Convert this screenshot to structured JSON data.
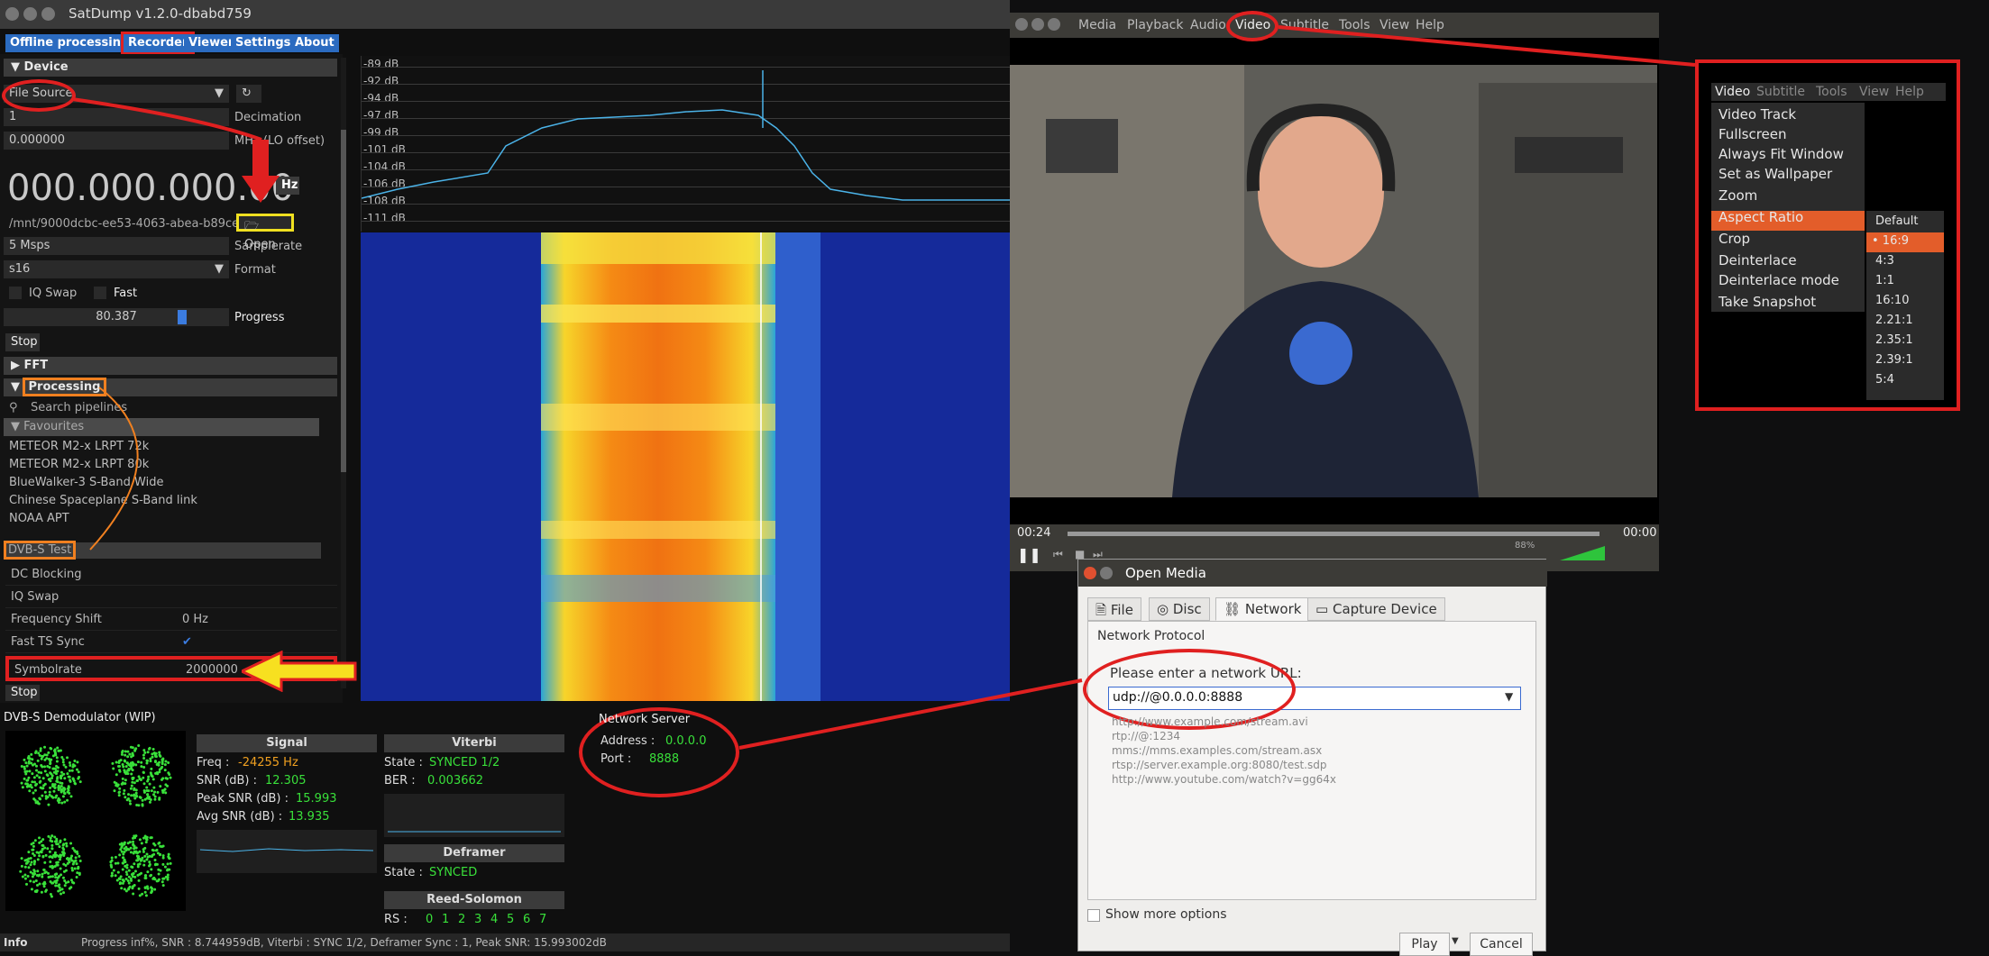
{
  "satdump": {
    "title": "SatDump v1.2.0-dbabd759",
    "menu": [
      "Offline processing",
      "Recorder",
      "Viewer",
      "Settings",
      "About"
    ],
    "device_header": "Device",
    "source": "File Source",
    "decimation_value": "1",
    "decimation_label": "Decimation",
    "lo_value": "0.000000",
    "lo_label": "MHz (LO offset)",
    "freq": "000.000.000.00",
    "hz": "Hz",
    "file_path": "/mnt/9000dcbc-ee53-4063-abea-b89ce",
    "open_label": "Open",
    "samplerate_value": "5 Msps",
    "samplerate_label": "Samplerate",
    "format_value": "s16",
    "format_label": "Format",
    "iq_swap": "IQ Swap",
    "fast": "Fast",
    "progress_value": "80.387",
    "progress_fraction": 0.80387,
    "progress_label": "Progress",
    "stop1": "Stop",
    "fft_header": "FFT",
    "processing_header": "Processing",
    "search_placeholder": "Search pipelines",
    "favourites": "Favourites",
    "pipelines": [
      "METEOR M2-x LRPT 72k",
      "METEOR M2-x LRPT 80k",
      "BlueWalker-3 S-Band Wide",
      "Chinese Spaceplane S-Band link",
      "NOAA APT",
      "DVB-S Test"
    ],
    "params": [
      {
        "k": "DC Blocking",
        "v": ""
      },
      {
        "k": "IQ Swap",
        "v": ""
      },
      {
        "k": "Frequency Shift",
        "v": "0 Hz"
      },
      {
        "k": "Fast TS Sync",
        "v": "✔"
      },
      {
        "k": "Symbolrate",
        "v": "2000000"
      }
    ],
    "stop2": "Stop",
    "db_ticks": [
      "-89 dB",
      "-92 dB",
      "-94 dB",
      "-97 dB",
      "-99 dB",
      "-101 dB",
      "-104 dB",
      "-106 dB",
      "-108 dB",
      "-111 dB"
    ],
    "demod_title": "DVB-S Demodulator (WIP)",
    "signal": {
      "header": "Signal",
      "freq_label": "Freq :",
      "freq": "-24255 Hz",
      "snr_label": "SNR (dB) :",
      "snr": "12.305",
      "peak_label": "Peak SNR (dB) :",
      "peak": "15.993",
      "avg_label": "Avg SNR (dB) :",
      "avg": "13.935"
    },
    "viterbi": {
      "header": "Viterbi",
      "state_label": "State :",
      "state": "SYNCED 1/2",
      "ber_label": "BER :",
      "ber": "0.003662"
    },
    "deframer": {
      "header": "Deframer",
      "state_label": "State :",
      "state": "SYNCED"
    },
    "rs": {
      "header": "Reed-Solomon",
      "label": "RS :",
      "values": [
        "0",
        "1",
        "2",
        "3",
        "4",
        "5",
        "6",
        "7"
      ]
    },
    "net": {
      "title": "Network Server",
      "addr_label": "Address :",
      "addr": "0.0.0.0",
      "port_label": "Port :",
      "port": "8888"
    },
    "status_info": "Info",
    "status_text": "Progress inf%, SNR : 8.744959dB, Viterbi : SYNC 1/2, Deframer Sync : 1, Peak SNR: 15.993002dB"
  },
  "vlc": {
    "menu": [
      "Media",
      "Playback",
      "Audio",
      "Video",
      "Subtitle",
      "Tools",
      "View",
      "Help"
    ],
    "time_left": "00:24",
    "time_right": "00:00",
    "volume": "88%"
  },
  "open_media": {
    "title": "Open Media",
    "tabs": [
      "File",
      "Disc",
      "Network",
      "Capture Device"
    ],
    "protocol": "Network Protocol",
    "prompt": "Please enter a network URL:",
    "url": "udp://@0.0.0.0:8888",
    "examples": [
      "http://www.example.com/stream.avi",
      "rtp://@:1234",
      "mms://mms.examples.com/stream.asx",
      "rtsp://server.example.org:8080/test.sdp",
      "http://www.youtube.com/watch?v=gg64x"
    ],
    "more": "Show more options",
    "play": "Play",
    "cancel": "Cancel"
  },
  "video_menu": {
    "bar": [
      "Video",
      "Subtitle",
      "Tools",
      "View",
      "Help"
    ],
    "items": [
      "Video Track",
      "Fullscreen",
      "Always Fit Window",
      "Set as Wallpaper",
      "Zoom",
      "Aspect Ratio",
      "Crop",
      "Deinterlace",
      "Deinterlace mode",
      "Take Snapshot"
    ],
    "aspect": [
      "Default",
      "16:9",
      "4:3",
      "1:1",
      "16:10",
      "2.21:1",
      "2.35:1",
      "2.39:1",
      "5:4"
    ]
  }
}
